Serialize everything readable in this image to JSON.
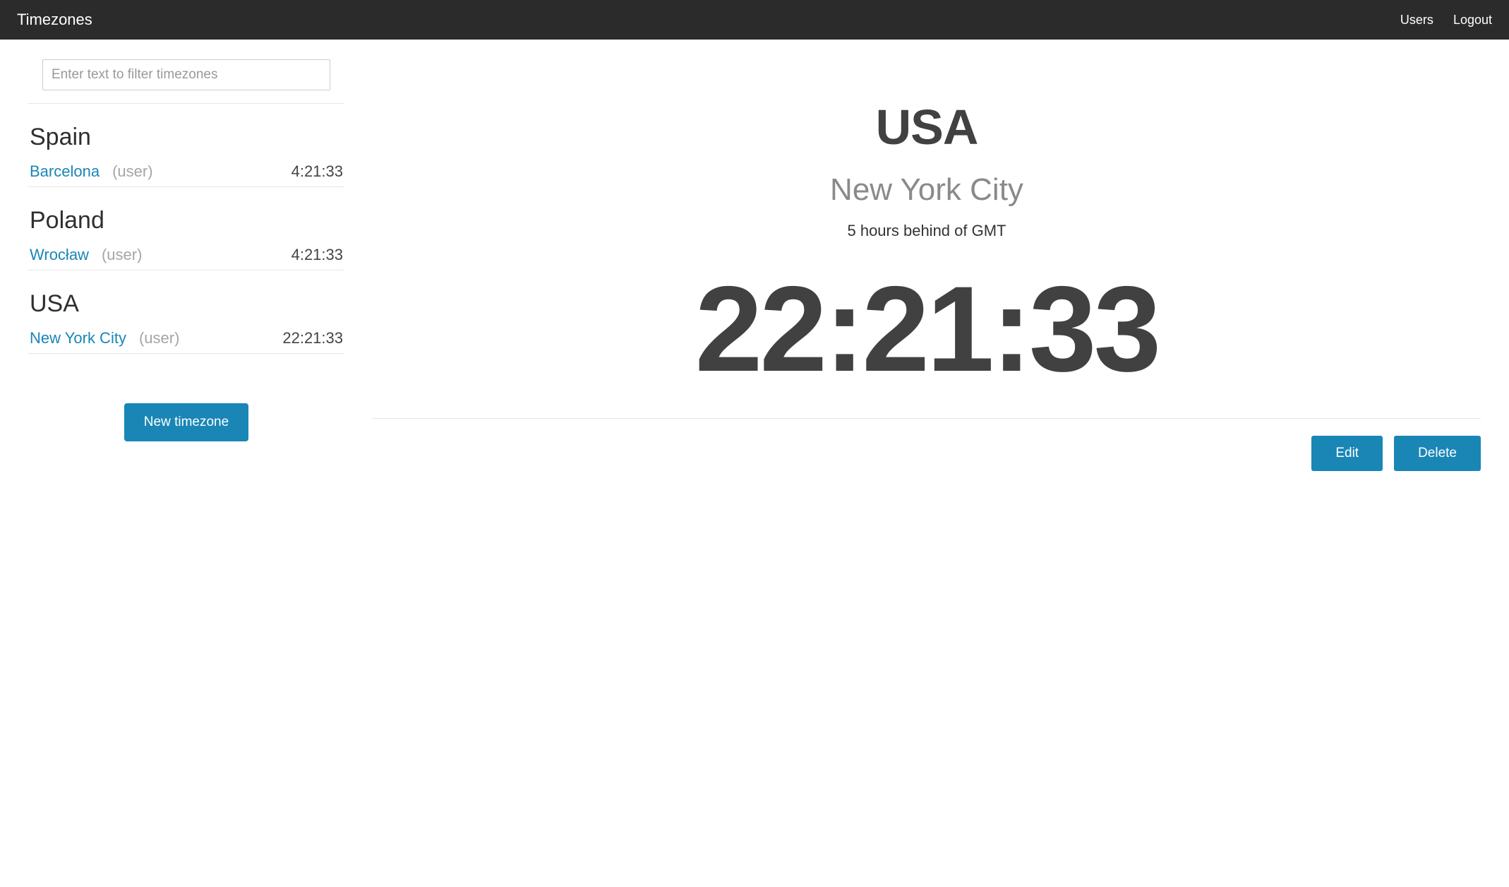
{
  "nav": {
    "brand": "Timezones",
    "users": "Users",
    "logout": "Logout"
  },
  "filter": {
    "placeholder": "Enter text to filter timezones"
  },
  "groups": [
    {
      "country": "Spain",
      "city": "Barcelona",
      "owner": "(user)",
      "time": "4:21:33"
    },
    {
      "country": "Poland",
      "city": "Wrocław",
      "owner": "(user)",
      "time": "4:21:33"
    },
    {
      "country": "USA",
      "city": "New York City",
      "owner": "(user)",
      "time": "22:21:33"
    }
  ],
  "buttons": {
    "new_timezone": "New timezone",
    "edit": "Edit",
    "delete": "Delete"
  },
  "detail": {
    "country": "USA",
    "city": "New York City",
    "offset_text": "5 hours behind of GMT",
    "time": "22:21:33"
  }
}
